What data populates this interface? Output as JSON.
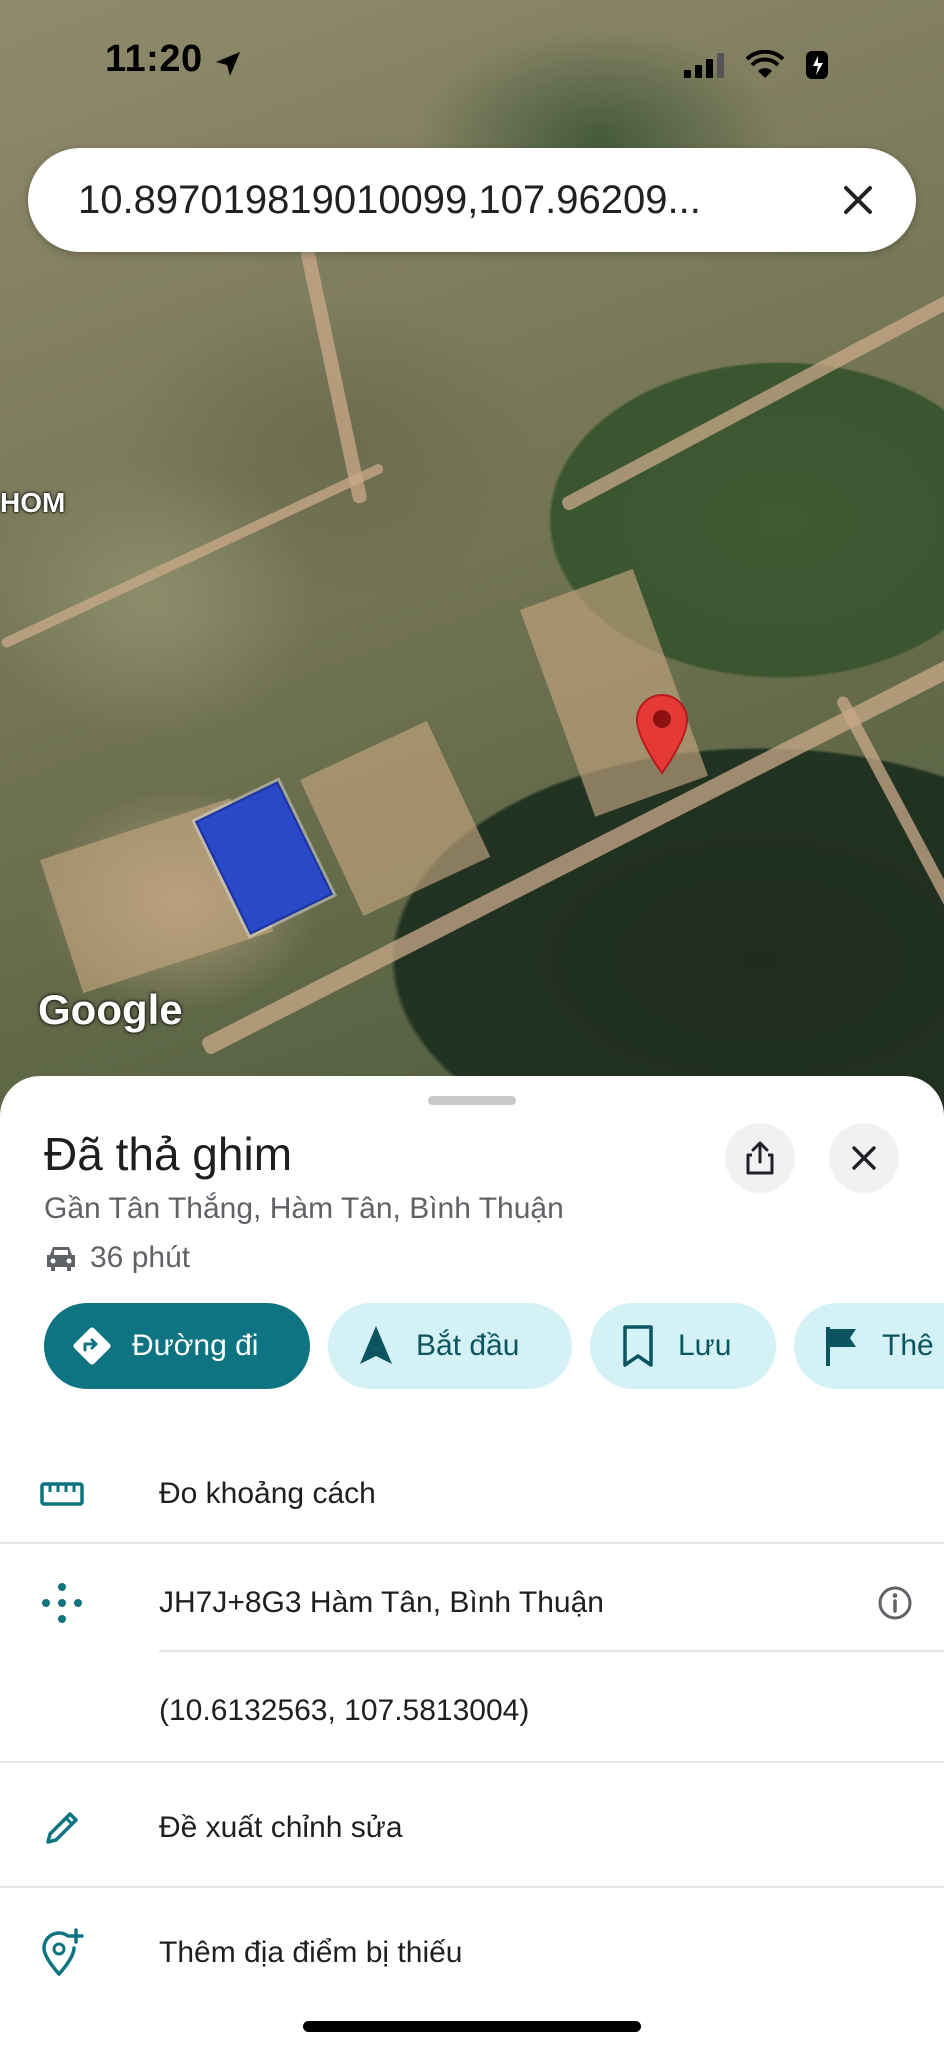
{
  "status_bar": {
    "time": "11:20"
  },
  "search": {
    "query": "10.897019819010099,107.96209..."
  },
  "map": {
    "label_fragment": "HOM",
    "logo": "Google"
  },
  "sheet": {
    "title": "Đã thả ghim",
    "subtitle": "Gần Tân Thắng, Hàm Tân, Bình Thuận",
    "eta": "36 phút",
    "chips": [
      {
        "label": "Đường đi",
        "icon": "directions-icon"
      },
      {
        "label": "Bắt đầu",
        "icon": "navigation-arrow-icon"
      },
      {
        "label": "Lưu",
        "icon": "bookmark-icon"
      },
      {
        "label": "Thê",
        "icon": "flag-icon"
      }
    ],
    "rows": {
      "measure": "Đo khoảng cách",
      "plus_code": "JH7J+8G3 Hàm Tân, Bình Thuận",
      "coordinates": "(10.6132563, 107.5813004)",
      "suggest_edit": "Đề xuất chỉnh sửa",
      "add_place": "Thêm địa điểm bị thiếu"
    }
  },
  "colors": {
    "primary": "#0e7481",
    "chip_secondary_bg": "#d4f1f6",
    "pin": "#e53935",
    "icon_teal": "#0e7481"
  }
}
